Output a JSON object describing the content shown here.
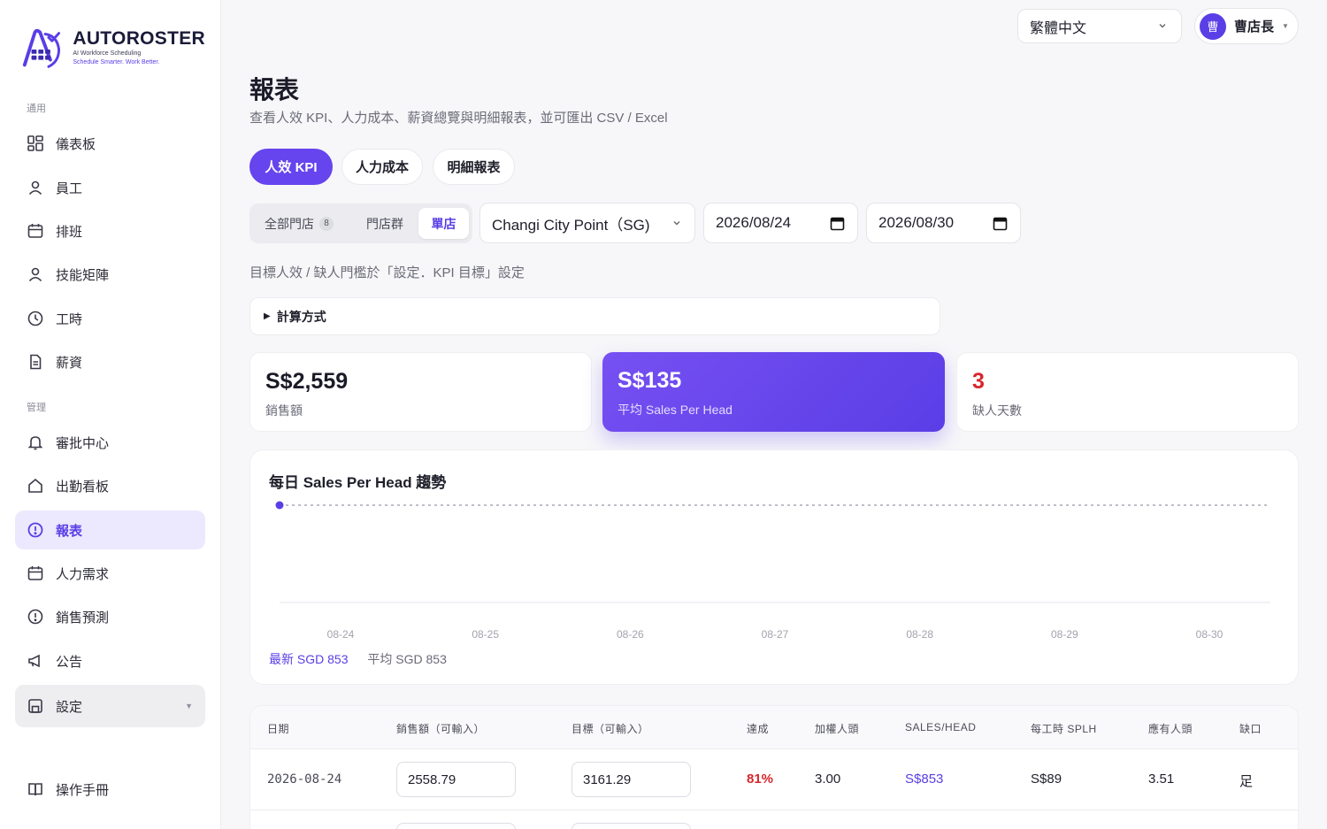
{
  "brand": {
    "name": "AUTOROSTER",
    "tagline_1": "AI Workforce Scheduling",
    "tagline_2": "Schedule Smarter. Work Better."
  },
  "sidebar": {
    "section_general": "通用",
    "section_manage": "管理",
    "general_items": [
      {
        "label": "儀表板",
        "icon": "dashboard-icon"
      },
      {
        "label": "員工",
        "icon": "user-icon"
      },
      {
        "label": "排班",
        "icon": "calendar-icon"
      },
      {
        "label": "技能矩陣",
        "icon": "user-icon"
      },
      {
        "label": "工時",
        "icon": "clock-icon"
      },
      {
        "label": "薪資",
        "icon": "document-icon"
      }
    ],
    "manage_items": [
      {
        "label": "審批中心",
        "icon": "bell-icon"
      },
      {
        "label": "出勤看板",
        "icon": "home-icon"
      },
      {
        "label": "報表",
        "icon": "alert-circle-icon",
        "active": true
      },
      {
        "label": "人力需求",
        "icon": "calendar-icon"
      },
      {
        "label": "銷售預測",
        "icon": "alert-circle-icon"
      },
      {
        "label": "公告",
        "icon": "megaphone-icon"
      },
      {
        "label": "設定",
        "icon": "save-icon"
      }
    ],
    "manual": "操作手冊"
  },
  "topbar": {
    "language": "繁體中文",
    "user_avatar": "曹",
    "user_name": "曹店長"
  },
  "page": {
    "title": "報表",
    "subtitle": "查看人效 KPI、人力成本、薪資總覽與明細報表，並可匯出 CSV / Excel"
  },
  "tabs": [
    "人效 KPI",
    "人力成本",
    "明細報表"
  ],
  "filters": {
    "scope_all": "全部門店",
    "scope_all_count": "8",
    "scope_group": "門店群",
    "scope_single": "單店",
    "store": "Changi City Point（SG)",
    "date_from": "2026/08/24",
    "date_to": "2026/08/30"
  },
  "hint": "目標人效 / 缺人門檻於「設定．KPI 目標」設定",
  "calc_method": "計算方式",
  "kpis": [
    {
      "value": "S$2,559",
      "label": "銷售額"
    },
    {
      "value": "S$135",
      "label": "平均 Sales Per Head"
    },
    {
      "value": "3",
      "label": "缺人天數"
    }
  ],
  "colors": {
    "accent": "#5a3ee6",
    "danger": "#d8262b"
  },
  "chart": {
    "title": "每日 Sales Per Head 趨勢",
    "latest": "最新 SGD 853",
    "average": "平均 SGD 853"
  },
  "chart_data": {
    "type": "line",
    "title": "每日 Sales Per Head 趨勢",
    "x": [
      "08-24",
      "08-25",
      "08-26",
      "08-27",
      "08-28",
      "08-29",
      "08-30"
    ],
    "series": [
      {
        "values": [
          853,
          null,
          null,
          null,
          null,
          null,
          null
        ]
      }
    ],
    "average_line": 853
  },
  "table": {
    "headers": [
      "日期",
      "銷售額（可輸入）",
      "目標（可輸入）",
      "達成",
      "加權人頭",
      "SALES/HEAD",
      "每工時 SPLH",
      "應有人頭",
      "缺口"
    ],
    "rows": [
      {
        "date": "2026-08-24",
        "sales": "2558.79",
        "target": "3161.29",
        "achieved": "81%",
        "heads": "3.00",
        "sph": "S$853",
        "splh": "S$89",
        "needed": "3.51",
        "gap": "足"
      }
    ]
  }
}
